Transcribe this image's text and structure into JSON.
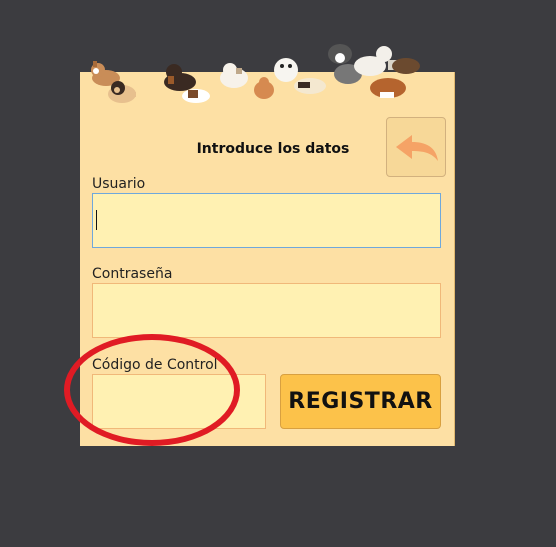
{
  "form": {
    "title": "Introduce los datos",
    "usuario_label": "Usuario",
    "usuario_value": "",
    "contrasena_label": "Contraseña",
    "contrasena_value": "",
    "codigo_label": "Código de Control",
    "codigo_value": "",
    "register_label": "REGISTRAR"
  },
  "icons": {
    "back": "back-arrow-icon",
    "header": "dogs-banner"
  },
  "colors": {
    "background": "#3c3c40",
    "panel": "#fde0a4",
    "field": "#fff1b2",
    "button": "#fcc24a",
    "back_arrow": "#f5a366",
    "annotation": "#e01b24"
  }
}
